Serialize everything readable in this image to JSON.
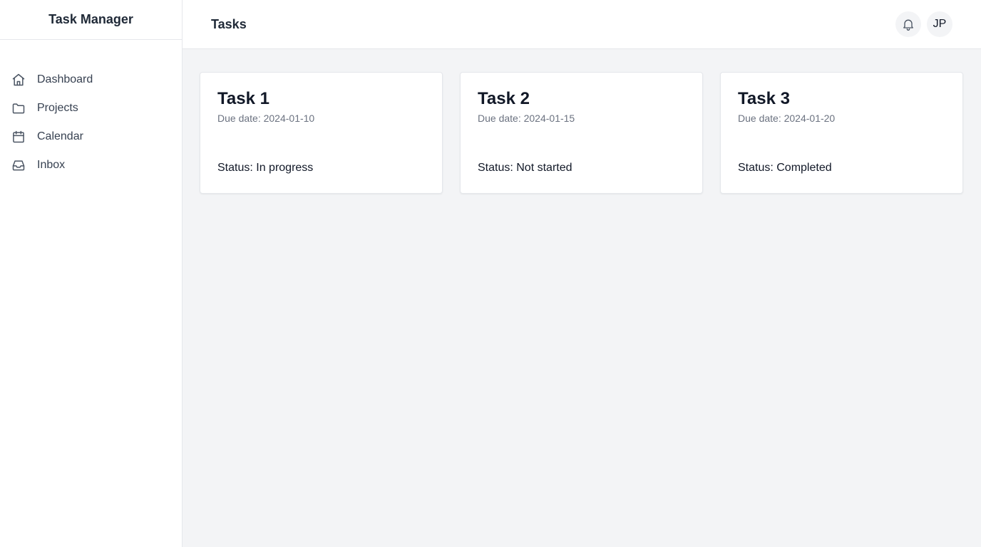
{
  "app": {
    "title": "Task Manager"
  },
  "sidebar": {
    "items": [
      {
        "label": "Dashboard",
        "icon": "home-icon"
      },
      {
        "label": "Projects",
        "icon": "folder-icon"
      },
      {
        "label": "Calendar",
        "icon": "calendar-icon"
      },
      {
        "label": "Inbox",
        "icon": "inbox-icon"
      }
    ]
  },
  "header": {
    "title": "Tasks",
    "notification_icon": "bell-icon",
    "avatar_initials": "JP"
  },
  "tasks": [
    {
      "title": "Task 1",
      "due": "Due date: 2024-01-10",
      "status": "Status: In progress"
    },
    {
      "title": "Task 2",
      "due": "Due date: 2024-01-15",
      "status": "Status: Not started"
    },
    {
      "title": "Task 3",
      "due": "Due date: 2024-01-20",
      "status": "Status: Completed"
    }
  ],
  "colors": {
    "background": "#f3f4f6",
    "surface": "#ffffff",
    "border": "#e5e7eb",
    "text_primary": "#111827",
    "text_muted": "#6b7280"
  }
}
